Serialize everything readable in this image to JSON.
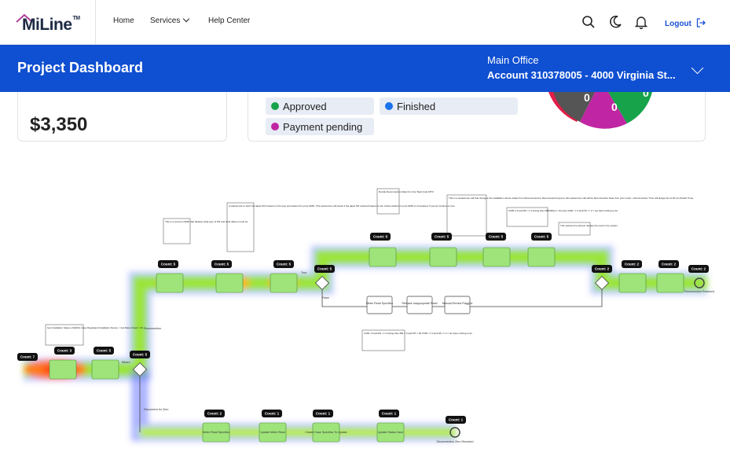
{
  "brand": {
    "name_prefix": "Mi",
    "name_suffix": "Line",
    "trademark": "TM"
  },
  "nav": {
    "home": "Home",
    "services": "Services",
    "help": "Help Center",
    "logout": "Logout"
  },
  "header": {
    "title": "Project Dashboard",
    "office": "Main Office",
    "account": "Account 310378005 - 4000 Virginia St..."
  },
  "summary": {
    "amount": "$3,350"
  },
  "legend": [
    {
      "label": "Approved",
      "color": "#16a34a"
    },
    {
      "label": "Finished",
      "color": "#1a73e8"
    },
    {
      "label": "Payment pending",
      "color": "#c026a3"
    }
  ],
  "pie": {
    "values": [
      0,
      0,
      0
    ],
    "colors": [
      "#555555",
      "#c026a3",
      "#16a34a",
      "#e11d48"
    ]
  },
  "process": {
    "counts": [
      "Count: 7",
      "Count: 3",
      "Count: 5",
      "Count: 5",
      "Count: 5",
      "Count: 5",
      "Count: 5",
      "Count: 5",
      "Count: 5",
      "Count: 5",
      "Count: 5",
      "Count: 5",
      "Count: 2",
      "Count: 2",
      "Count: 2",
      "Count: 2",
      "Count: 2",
      "Count: 1",
      "Count: 1",
      "Count: 1",
      "Count: 1",
      "Count: 2"
    ],
    "labels": {
      "reconnection": "Reconnection",
      "false": "False",
      "true": "True",
      "where": "Where",
      "disconnect": "Disconnect for Zero",
      "meter_read": "Meter Read Specifics",
      "release": "Release Inappropriate Read",
      "manual": "Manual Review Flagged",
      "update_meter": "Update Meter Read",
      "meter_spec": "Meter Read Specifics",
      "closed": "Closed Case Specifics To Update",
      "update_status": "Update Status Case",
      "disconnect_end": "Disconnection Zero Resolved",
      "reconnect_end": "Reconnection Resolved"
    },
    "notes": {
      "n1": "Get Installation Status of EMAIL Case Regulated Installation Device > Get Meter Read > FS",
      "n2": "This is a common DMN that dictates what type of SN and what dates to look for",
      "n3": "A webservice to fetch the latest SN's based on the type and status from prior DMN. This webservice will check if the latest SN retrieved based on the criteria defined in prior DMN is Completed. If yes let continue to true",
      "n4": "Decide Reconnection Date from the Task Code MTO",
      "n5": "This is a webservice call that changes the installation device status from Disconnected to Reconnected (input to this webservice call will be Reconnection Date from prior script + Reconnection Time will always be 11:00 am Pacific Time)",
      "n6": "If MR (>0 and RS >= 2 Acting then MR/MR(n) = Hit stop If MR <= 0 and RS <= 2 = set hard nothing to do",
      "n7": "This webservice will just release the read in the system",
      "n8": "If MR >0 and RS >= 2 Acting then MR = 0 and MT = 0# If MR <= 0 and RS <= 2 = do have nothing to do"
    }
  }
}
